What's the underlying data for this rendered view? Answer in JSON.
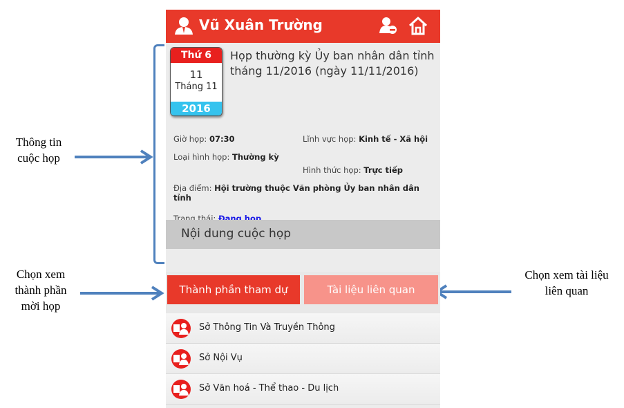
{
  "annotations": {
    "meeting_info": [
      "Thông tin",
      "cuộc họp"
    ],
    "choose_participants": [
      "Chọn xem",
      "thành phần",
      "mời họp"
    ],
    "choose_documents": [
      "Chọn xem tài liệu",
      "liên quan"
    ]
  },
  "appbar": {
    "user_name": "Vũ Xuân Trường",
    "color": "#e8392a"
  },
  "calendar": {
    "day_of_week": "Thứ 6",
    "day": "11",
    "month": "Tháng 11",
    "year": "2016"
  },
  "meeting": {
    "title": "Họp thường kỳ Ủy ban nhân dân tỉnh tháng 11/2016 (ngày 11/11/2016)",
    "time_label": "Giờ họp: ",
    "time_value": "07:30",
    "field_label": "Lĩnh vực họp: ",
    "field_value": "Kinh tế - Xã hội",
    "type_label": "Loại hình họp: ",
    "type_value": "Thường kỳ",
    "form_label": "Hình thức họp: ",
    "form_value": "Trực tiếp",
    "location_label": "Địa điểm: ",
    "location_value": "Hội trường thuộc Văn phòng Ủy ban nhân dân tỉnh",
    "status_label": "Trạng thái: ",
    "status_value": "Đang họp",
    "status_color": "#1a1ae6"
  },
  "section": {
    "content_label": "Nội dung cuộc họp"
  },
  "tabs": {
    "participants": "Thành phần tham dự",
    "documents": "Tài liệu liên quan"
  },
  "participants": [
    {
      "name": "Sở Thông Tin Và Truyền Thông",
      "icon": "participant-icon"
    },
    {
      "name": "Sở Nội Vụ",
      "icon": "participant-icon"
    },
    {
      "name": "Sở Văn hoá - Thể thao - Du lịch",
      "icon": "participant-icon"
    }
  ]
}
